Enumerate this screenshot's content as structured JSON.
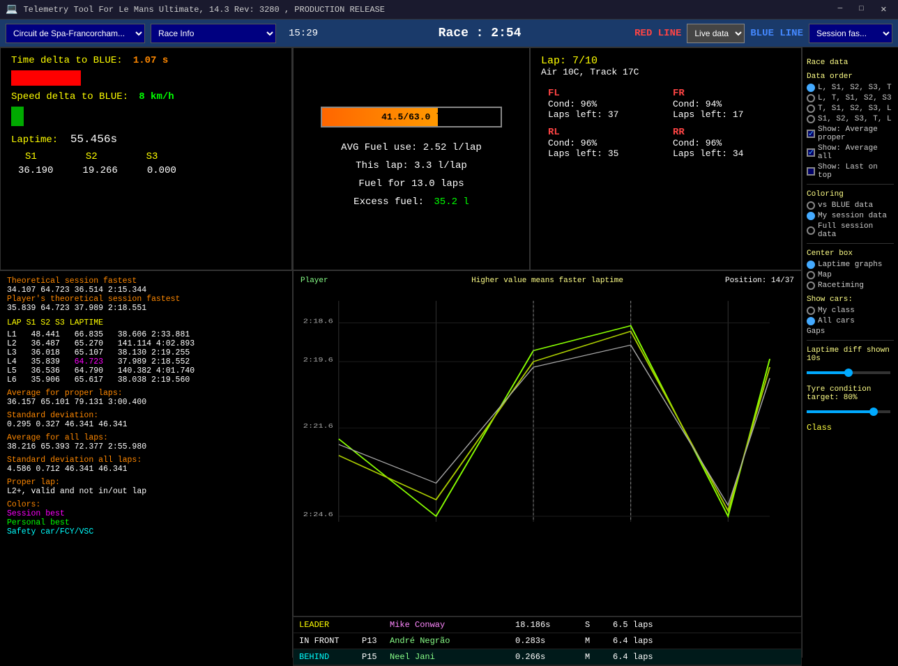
{
  "titlebar": {
    "title": "Telemetry Tool For Le Mans Ultimate, 14.3 Rev: 3280 , PRODUCTION RELEASE",
    "min_label": "─",
    "max_label": "□",
    "close_label": "✕"
  },
  "toolbar": {
    "circuit": "Circuit de Spa-Francorcham...",
    "race_info": "Race Info",
    "time": "15:29",
    "race": "Race : 2:54",
    "red_line": "RED LINE",
    "live_data": "Live data",
    "blue_line": "BLUE LINE",
    "session": "Session fas..."
  },
  "telemetry": {
    "time_delta_label": "Time delta to BLUE:",
    "time_delta_val": "1.07 s",
    "speed_delta_label": "Speed delta to BLUE:",
    "speed_delta_val": "8 km/h",
    "laptime_label": "Laptime:",
    "laptime_val": "55.456s",
    "s1_label": "S1",
    "s2_label": "S2",
    "s3_label": "S3",
    "s1_val": "36.190",
    "s2_val": "19.266",
    "s3_val": "0.000"
  },
  "lap_data": {
    "theory_fastest_label": "Theoretical session fastest",
    "theory_fastest_vals": "   34.107   64.723   36.514  2:15.344",
    "theory_player_label": "Player's theoretical session fastest",
    "theory_player_vals": "   35.839   64.723   37.989  2:18.551",
    "header": "LAP      S1       S2       S3    LAPTIME",
    "laps": [
      {
        "lap": "L1",
        "s1": "48.441",
        "s2": "66.835",
        "s3": "38.606",
        "time": "2:33.881",
        "highlight": false
      },
      {
        "lap": "L2",
        "s1": "36.487",
        "s2": "65.270",
        "s3": "141.114",
        "time": "4:02.893",
        "highlight": false
      },
      {
        "lap": "L3",
        "s1": "36.018",
        "s2": "65.107",
        "s3": "38.130",
        "time": "2:19.255",
        "highlight": false
      },
      {
        "lap": "L4",
        "s1": "35.839",
        "s2": "64.723",
        "s3": "37.989",
        "time": "2:18.552",
        "highlight": true
      },
      {
        "lap": "L5",
        "s1": "36.536",
        "s2": "64.790",
        "s3": "140.382",
        "time": "4:01.740",
        "highlight": false
      },
      {
        "lap": "L6",
        "s1": "35.906",
        "s2": "65.617",
        "s3": "38.038",
        "time": "2:19.560",
        "highlight": false
      }
    ],
    "avg_proper_label": "Average for proper laps:",
    "avg_proper_vals": "   36.157   65.101   79.131  3:00.400",
    "std_dev_label": "Standard deviation:",
    "std_dev_vals": "    0.295    0.327   46.341    46.341",
    "avg_all_label": "Average for all laps:",
    "avg_all_vals": "   38.216   65.393   72.377  2:55.980",
    "std_all_label": "Standard deviation all laps:",
    "std_all_vals": "    4.586    0.712   46.341    46.341",
    "proper_label": "Proper lap:",
    "proper_val": "  L2+, valid and not in/out lap",
    "colors_label": "Colors:",
    "color_session": "Session best",
    "color_personal": "Personal best",
    "color_safety": "Safety car/FCY/VSC"
  },
  "fuel": {
    "bar_text": "41.5/63.0 l",
    "avg_label": "AVG Fuel use: 2.52 l/lap",
    "this_lap_label": "This lap: 3.3 l/lap",
    "fuel_for_label": "Fuel for 13.0 laps",
    "excess_label": "Excess fuel:",
    "excess_val": "35.2 l"
  },
  "tyre": {
    "lap_label": "Lap: 7/10",
    "air_label": "Air 10C, Track 17C",
    "fl_name": "FL",
    "fr_name": "FR",
    "rl_name": "RL",
    "rr_name": "RR",
    "fl_cond": "Cond: 96%",
    "fr_cond": "Cond: 94%",
    "rl_cond": "Cond: 96%",
    "rr_cond": "Cond: 96%",
    "fl_laps": "Laps left: 37",
    "fr_laps": "Laps left: 17",
    "rl_laps": "Laps left: 35",
    "rr_laps": "Laps left: 34"
  },
  "chart": {
    "player_label": "Player",
    "title": "Higher value means faster laptime",
    "position_label": "Position: 14/37",
    "y_labels": [
      "2:18.6",
      "2:19.6",
      "2:21.6",
      "2:24.6"
    ]
  },
  "leaderboard": {
    "rows": [
      {
        "role": "LEADER",
        "pos": "",
        "name": "Mike Conway",
        "gap": "18.186s",
        "tyre": "S",
        "fuel": "6.5 laps"
      },
      {
        "role": "IN FRONT",
        "pos": "P13",
        "name": "André Negrão",
        "gap": "0.283s",
        "tyre": "M",
        "fuel": "6.4 laps"
      },
      {
        "role": "BEHIND",
        "pos": "P15",
        "name": "Neel Jani",
        "gap": "0.266s",
        "tyre": "M",
        "fuel": "6.4 laps"
      }
    ]
  },
  "right_panel": {
    "race_data_label": "Race data",
    "data_order_label": "Data order",
    "data_order_options": [
      {
        "label": "L, S1, S2, S3, T",
        "selected": true
      },
      {
        "label": "L, T, S1, S2, S3",
        "selected": false
      },
      {
        "label": "T, S1, S2, S3, L",
        "selected": false
      },
      {
        "label": "S1, S2, S3, T, L",
        "selected": false
      }
    ],
    "show_avg_proper_label": "Show: Average proper",
    "show_avg_proper_checked": true,
    "show_avg_all_label": "Show: Average all",
    "show_avg_all_checked": true,
    "show_last_on_top_label": "Show: Last on top",
    "show_last_on_top_checked": false,
    "coloring_label": "Coloring",
    "coloring_options": [
      {
        "label": "vs BLUE data",
        "selected": false
      },
      {
        "label": "My session data",
        "selected": true
      },
      {
        "label": "Full session data",
        "selected": false
      }
    ],
    "center_box_label": "Center box",
    "center_box_options": [
      {
        "label": "Laptime graphs",
        "selected": true
      },
      {
        "label": "Map",
        "selected": false
      },
      {
        "label": "Racetiming",
        "selected": false
      }
    ],
    "show_cars_label": "Show cars:",
    "show_cars_options": [
      {
        "label": "My class",
        "selected": false
      },
      {
        "label": "All cars",
        "selected": true
      }
    ],
    "gaps_label": "Gaps",
    "laptime_diff_label": "Laptime diff shown 10s",
    "tyre_target_label": "Tyre condition target: 80%",
    "class_label": "Class"
  }
}
